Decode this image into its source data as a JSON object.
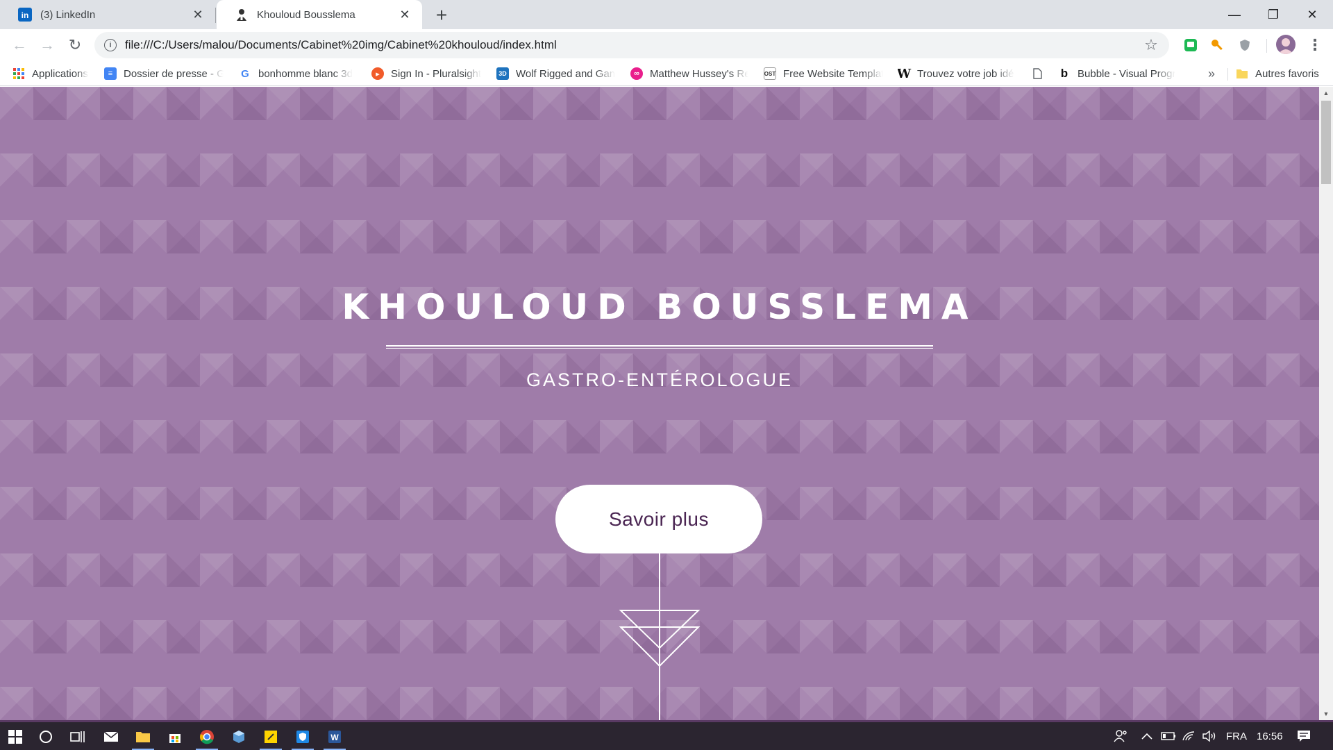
{
  "tabs": [
    {
      "title": "(3) LinkedIn",
      "active": false
    },
    {
      "title": "Khouloud Bousslema",
      "active": true
    }
  ],
  "window_controls": {
    "minimize": "—",
    "maximize": "❐",
    "close": "✕"
  },
  "address_bar": {
    "url": "file:///C:/Users/malou/Documents/Cabinet%20img/Cabinet%20khouloud/index.html"
  },
  "bookmarks": {
    "items": [
      {
        "label": "Applications",
        "icon": "apps-grid-icon"
      },
      {
        "label": "Dossier de presse - G",
        "icon": "google-docs-icon"
      },
      {
        "label": "bonhomme blanc 3d",
        "icon": "google-icon"
      },
      {
        "label": "Sign In - Pluralsight",
        "icon": "pluralsight-icon"
      },
      {
        "label": "Wolf Rigged and Gan",
        "icon": "3d-icon"
      },
      {
        "label": "Matthew Hussey's Re",
        "icon": "infinity-icon"
      },
      {
        "label": "Free Website Templat",
        "icon": "ost-icon"
      },
      {
        "label": "Trouvez votre job idé",
        "icon": "w-icon"
      },
      {
        "label": "",
        "icon": "page-icon"
      },
      {
        "label": "Bubble - Visual Progr",
        "icon": "bubble-icon"
      }
    ],
    "overflow": "»",
    "other_favorites": "Autres favoris"
  },
  "page": {
    "title": "KHOULOUD BOUSSLEMA",
    "subtitle": "GASTRO-ENTÉROLOGUE",
    "cta": "Savoir plus"
  },
  "taskbar": {
    "language": "FRA",
    "time": "16:56"
  },
  "colors": {
    "hero_background": "#9f7ca9",
    "button_text": "#4a2552",
    "taskbar": "#2b2530"
  }
}
